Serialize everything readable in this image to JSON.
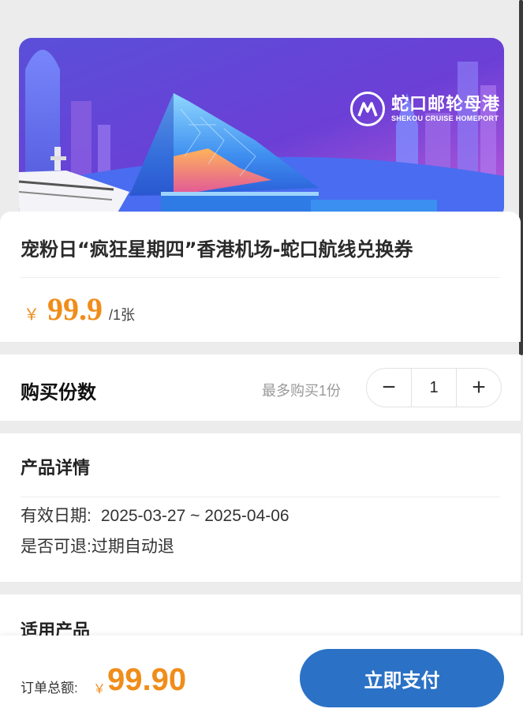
{
  "banner": {
    "brand_cn": "蛇口邮轮母港",
    "brand_en": "SHEKOU CRUISE HOMEPORT"
  },
  "product": {
    "title": "宠粉日“疯狂星期四”香港机场-蛇口航线兑换券",
    "currency": "￥",
    "price": "99.9",
    "unit": "/1张"
  },
  "quantity": {
    "label": "购买份数",
    "limit": "最多购买1份",
    "minus": "−",
    "plus": "+",
    "value": "1"
  },
  "details": {
    "title": "产品详情",
    "validity_label": "有效日期:",
    "validity_value": "2025-03-27 ~ 2025-04-06",
    "refund_label": "是否可退:",
    "refund_value": "过期自动退"
  },
  "applicable": {
    "title": "适用产品"
  },
  "footer": {
    "total_label": "订单总额:",
    "currency": "￥",
    "total": "99.90",
    "pay_label": "立即支付"
  },
  "colors": {
    "accent_orange": "#f08d1a",
    "primary_blue": "#2b72c6"
  }
}
